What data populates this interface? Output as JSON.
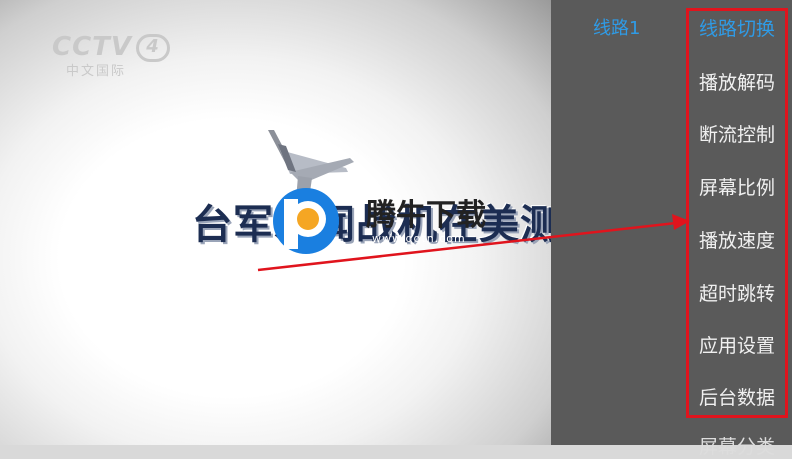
{
  "video": {
    "channel_logo": "CCTV",
    "channel_number": "4",
    "channel_subtitle": "中文国际",
    "caption": "台军新闻战机在美测试",
    "watermark_text": "腾牛下载",
    "watermark_url": "www.qqtn.com"
  },
  "panel": {
    "current_line": "线路1",
    "menu": [
      {
        "label": "线路切换",
        "active": true
      },
      {
        "label": "播放解码",
        "active": false
      },
      {
        "label": "断流控制",
        "active": false
      },
      {
        "label": "屏幕比例",
        "active": false
      },
      {
        "label": "播放速度",
        "active": false
      },
      {
        "label": "超时跳转",
        "active": false
      },
      {
        "label": "应用设置",
        "active": false
      },
      {
        "label": "后台数据",
        "active": false
      },
      {
        "label": "屏幕分类",
        "active": false
      }
    ]
  },
  "colors": {
    "accent": "#2f9be6",
    "highlight_border": "#e0141d",
    "panel_bg": "#5a5a5a"
  }
}
